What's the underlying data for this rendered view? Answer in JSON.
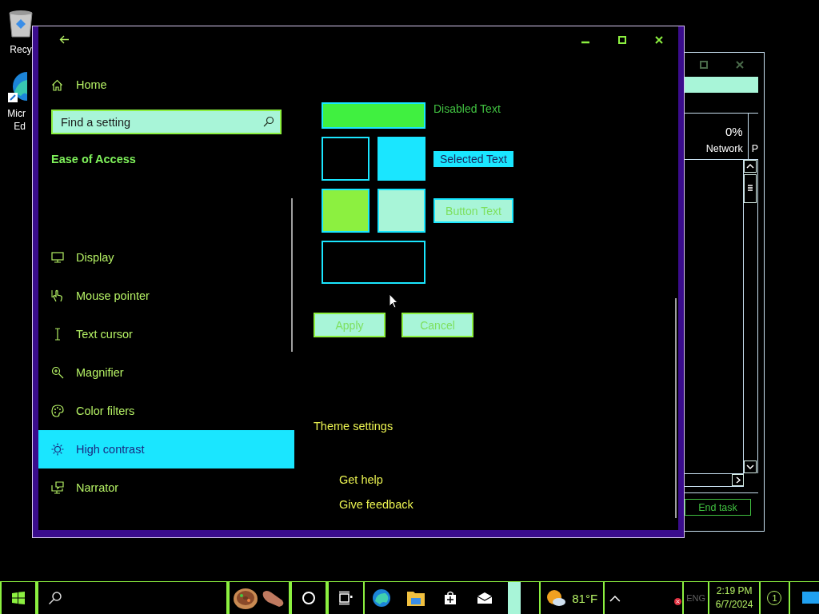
{
  "desktop_icons": [
    {
      "lines": [
        "Recy"
      ]
    },
    {
      "lines": [
        "Micr",
        "Ed"
      ]
    }
  ],
  "task_manager": {
    "network_usage": "0%",
    "network_label": "Network",
    "column_3": "P",
    "end_task": "End task"
  },
  "settings_window": {
    "sidebar": {
      "home": "Home",
      "search": {
        "placeholder": "Find a setting"
      },
      "section": "Ease of Access",
      "items": [
        {
          "label": "Display",
          "selected": false
        },
        {
          "label": "Mouse pointer",
          "selected": false
        },
        {
          "label": "Text cursor",
          "selected": false
        },
        {
          "label": "Magnifier",
          "selected": false
        },
        {
          "label": "Color filters",
          "selected": false
        },
        {
          "label": "High contrast",
          "selected": true
        },
        {
          "label": "Narrator",
          "selected": false
        }
      ]
    },
    "content": {
      "swatches": [
        {
          "kind": "wide",
          "color": "#40f040"
        },
        {
          "kind": "square",
          "color": "#000000"
        },
        {
          "kind": "square",
          "color": "#1ae6ff"
        },
        {
          "kind": "square",
          "color": "#8cf040"
        },
        {
          "kind": "square",
          "color": "#a8f5d8"
        },
        {
          "kind": "wide",
          "color": "#000000"
        }
      ],
      "disabled_text": "Disabled Text",
      "selected_text": "Selected Text",
      "button_text": "Button Text",
      "buttons": [
        "Apply",
        "Cancel"
      ],
      "theme_link": "Theme settings",
      "help_links": [
        "Get help",
        "Give feedback"
      ]
    }
  },
  "taskbar": {
    "weather": "81°F",
    "language": "ENG",
    "time": "2:19 PM",
    "date": "6/7/2024",
    "notification_count": "1"
  }
}
